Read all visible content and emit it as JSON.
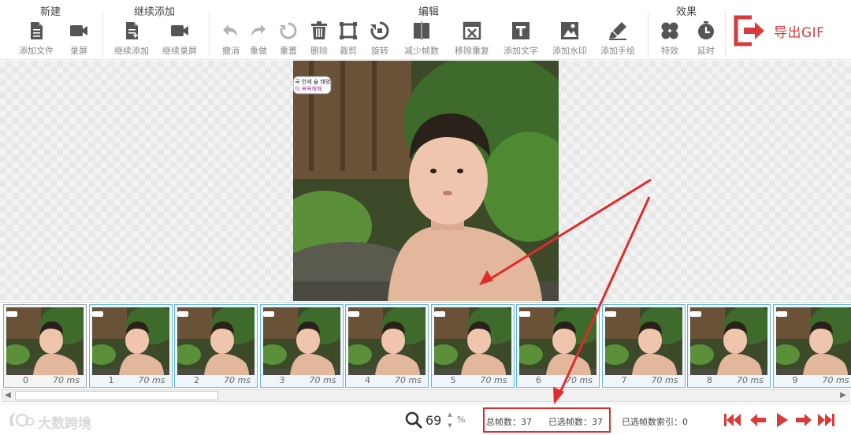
{
  "toolbar": {
    "groups": {
      "new": "新建",
      "continue": "继续添加",
      "edit": "编辑",
      "effects": "效果"
    },
    "buttons": {
      "add_file": "添加文件",
      "record_screen": "录屏",
      "continue_add": "继续添加",
      "continue_record": "继续录屏",
      "undo": "撤消",
      "redo": "重做",
      "reset": "重置",
      "delete": "删除",
      "crop": "裁剪",
      "rotate": "旋转",
      "reduce_frames": "减少帧数",
      "remove_duplicates": "移除重复",
      "add_text": "添加文字",
      "add_watermark": "添加水印",
      "add_drawing": "添加手绘",
      "effects": "特效",
      "delay": "延时"
    },
    "export": "导出GIF"
  },
  "preview": {
    "sticker_line1": "국 안세 슬 태양",
    "sticker_line2": "이 욕욕해해"
  },
  "frames": [
    {
      "index": "0",
      "duration": "70 ms"
    },
    {
      "index": "1",
      "duration": "70 ms"
    },
    {
      "index": "2",
      "duration": "70 ms"
    },
    {
      "index": "3",
      "duration": "70 ms"
    },
    {
      "index": "4",
      "duration": "70 ms"
    },
    {
      "index": "5",
      "duration": "70 ms"
    },
    {
      "index": "6",
      "duration": "70 ms"
    },
    {
      "index": "7",
      "duration": "70 ms"
    },
    {
      "index": "8",
      "duration": "70 ms"
    },
    {
      "index": "9",
      "duration": "70 ms"
    }
  ],
  "status": {
    "watermark": "大数跨境",
    "zoom_value": "69",
    "zoom_unit": "%",
    "total_frames": "总帧数：37",
    "selected_frames": "已选帧数：37",
    "selected_index": "已选帧数索引：0"
  },
  "colors": {
    "accent_red": "#d93a3a",
    "annotation_red": "#e02b2b",
    "frame_border": "#62b3e6",
    "icon_gray": "#555555"
  }
}
